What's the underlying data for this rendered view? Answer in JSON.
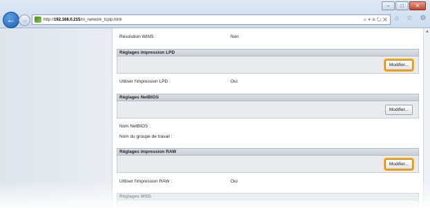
{
  "browser": {
    "url_prefix": "http://",
    "url_host": "192.168.0.215",
    "url_path": "/m_network_tcpip.html",
    "address_tools": "⌕ ▾ ≡ ↻ ✕",
    "toolbar_icons": "⌂ ☆ ⚙",
    "window_controls": {
      "minimize": "–",
      "maximize": "□",
      "close": "✕"
    },
    "back_glyph": "←",
    "forward_glyph": "→"
  },
  "content": {
    "wins_resolution_label": "Résolution WINS :",
    "wins_resolution_value": "Non",
    "sections": [
      {
        "title": "Réglages impression LPD",
        "button": "Modifier...",
        "highlighted": true,
        "fields": [
          {
            "label": "Utiliser l'impression LPD :",
            "value": "Oui"
          }
        ]
      },
      {
        "title": "Réglages NetBIOS",
        "button": "Modifier...",
        "highlighted": false,
        "fields": [
          {
            "label": "Nom NetBIOS :",
            "value": ""
          },
          {
            "label": "Nom du groupe de travail :",
            "value": ""
          }
        ]
      },
      {
        "title": "Réglages impression RAW",
        "button": "Modifier...",
        "highlighted": true,
        "fields": [
          {
            "label": "Utiliser l'impression RAW :",
            "value": "Oui"
          }
        ]
      },
      {
        "title": "Réglages WSD",
        "button": "",
        "highlighted": false,
        "fields": []
      }
    ]
  },
  "colors": {
    "highlight": "#f3a81d"
  }
}
